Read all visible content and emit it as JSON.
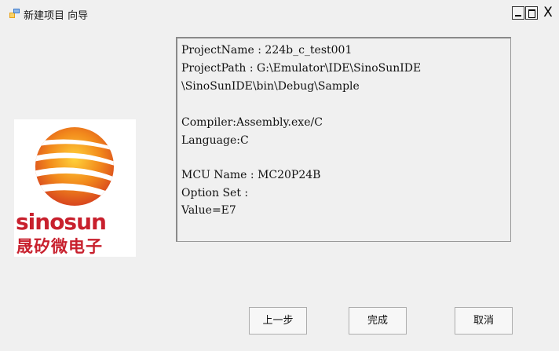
{
  "window": {
    "title": "新建项目 向导",
    "controls": {
      "minimize": "_",
      "maximize": "□",
      "close": "X"
    }
  },
  "logo": {
    "brand_en": "sinosun",
    "brand_cn": "晟矽微电子",
    "colors": {
      "brand_red": "#c8202d",
      "sun_orange": "#f08a1c"
    }
  },
  "info": {
    "lines": [
      "ProjectName : 224b_c_test001",
      "ProjectPath : G:\\Emulator\\IDE\\SinoSunIDE",
      "\\SinoSunIDE\\bin\\Debug\\Sample",
      "",
      "Compiler:Assembly.exe/C",
      "Language:C",
      "",
      "MCU Name : MC20P24B",
      "Option Set :",
      "Value=E7"
    ]
  },
  "buttons": {
    "back": "上一步",
    "finish": "完成",
    "cancel": "取消"
  }
}
